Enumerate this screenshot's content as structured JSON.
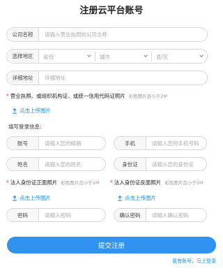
{
  "page_title": "注册云平台账号",
  "company": {
    "label": "公司名称",
    "placeholder": "请输入营业执照的公司全称"
  },
  "region": {
    "label": "选择地区",
    "province": "省份",
    "city": "城市",
    "district": "县/区"
  },
  "address": {
    "label": "详细地址",
    "placeholder": "详细地址"
  },
  "license": {
    "required_mark": "*",
    "label": "营业执照、或组织机构证、或统一信用代码证照片",
    "hint": "彩色图片且小于2M",
    "upload": "点击上传图片"
  },
  "login_section_title": "填写登录信息:",
  "account": {
    "label": "账号",
    "placeholder": "请输入您的邮箱"
  },
  "phone": {
    "label": "手机",
    "placeholder": "请输入您的手机号码"
  },
  "name": {
    "label": "姓名",
    "placeholder": "请输入您的姓名"
  },
  "idcard": {
    "label": "身份证",
    "placeholder": "请输入您的身份证"
  },
  "id_front": {
    "required_mark": "*",
    "label": "法人身份证正面照片",
    "hint": "彩色图片且小于2M",
    "upload": "点击上传图片"
  },
  "id_back": {
    "required_mark": "*",
    "label": "法人身份证反面照片",
    "hint": "彩色图片且小于2M",
    "upload": "点击上传图片"
  },
  "password": {
    "label": "密码",
    "placeholder": "请输入密码"
  },
  "confirm_password": {
    "label": "确认密码",
    "placeholder": "请输入确认密码"
  },
  "submit_label": "提交注册",
  "login_link": "我有账号，马上登录",
  "colors": {
    "accent": "#2f93ef",
    "link": "#1a8fe8",
    "required": "#e4393c"
  },
  "icons": {
    "upload": "upload-icon",
    "dropdown": "chevron-down-icon"
  }
}
